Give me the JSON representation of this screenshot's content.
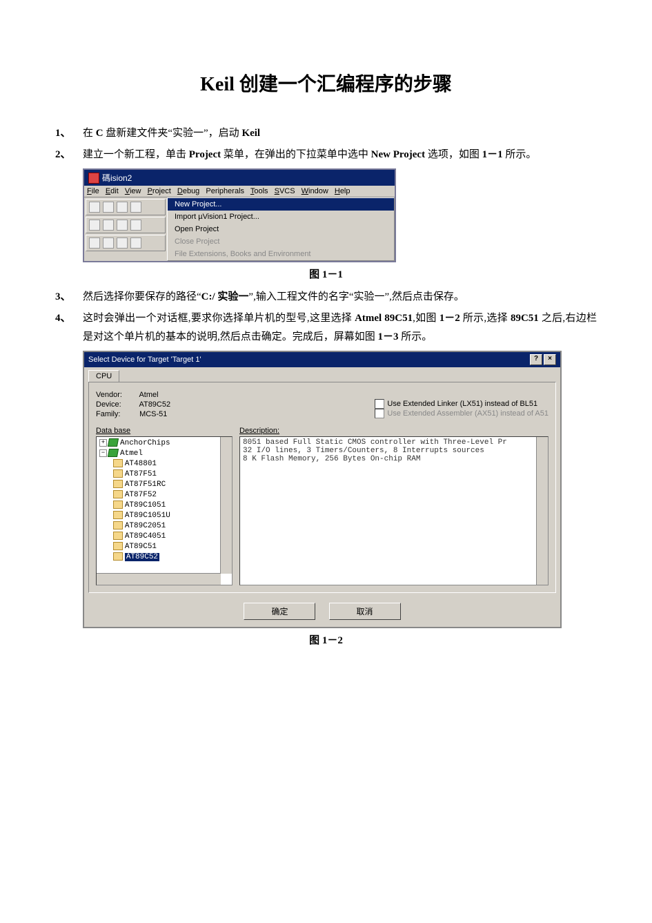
{
  "title": "Keil 创建一个汇编程序的步骤",
  "steps": {
    "s1": {
      "num": "1、",
      "text_a": "在 ",
      "b1": "C",
      "text_b": " 盘新建文件夹“实验一”，启动 ",
      "b2": "Keil"
    },
    "s2": {
      "num": "2、",
      "text_a": "建立一个新工程，单击 ",
      "b1": "Project",
      "text_b": " 菜单，在弹出的下拉菜单中选中 ",
      "b2": "New  Project",
      "text_c": " 选项，如图 ",
      "b3": "1－1",
      "text_d": " 所示。"
    },
    "s3": {
      "num": "3、",
      "text_a": "然后选择你要保存的路径“",
      "b1": "C:/  实验一",
      "text_b": "”,输入工程文件的名字“实验一”,然后点击保存。"
    },
    "s4": {
      "num": "4、",
      "text_a": "这时会弹出一个对话框,要求你选择单片机的型号,这里选择 ",
      "b1": "Atmel  89C51",
      "text_b": ",如图 ",
      "b2": "1－2",
      "text_c": " 所示,选择 ",
      "b3": "89C51",
      "text_d": " 之后,右边栏是对这个单片机的基本的说明,然后点击确定。完成后，屏幕如图 ",
      "b4": "1－3",
      "text_e": " 所示。"
    }
  },
  "fig_captions": {
    "c1": "图 1－1",
    "c2": "图 1－2"
  },
  "uvision": {
    "app_title": "碼ision2",
    "menubar": [
      "File",
      "Edit",
      "View",
      "Project",
      "Debug",
      "Peripherals",
      "Tools",
      "SVCS",
      "Window",
      "Help"
    ],
    "dropdown": [
      {
        "label": "New Project...",
        "selected": true,
        "disabled": false
      },
      {
        "label": "Import µVision1 Project...",
        "selected": false,
        "disabled": false
      },
      {
        "label": "Open Project",
        "selected": false,
        "disabled": false
      },
      {
        "label": "Close Project",
        "selected": false,
        "disabled": true
      },
      {
        "label": "File Extensions, Books and Environment",
        "selected": false,
        "disabled": true
      }
    ]
  },
  "device": {
    "dialog_title": "Select Device for Target 'Target 1'",
    "tab": "CPU",
    "vendor_label": "Vendor:",
    "vendor": "Atmel",
    "device_label": "Device:",
    "device_val": "AT89C52",
    "family_label": "Family:",
    "family": "MCS-51",
    "chk1": "Use Extended Linker (LX51) instead of BL51",
    "chk2": "Use Extended Assembler (AX51) instead of A51",
    "database_label": "Data base",
    "desc_label": "Description:",
    "tree": {
      "root1": "AnchorChips",
      "root2": "Atmel",
      "items": [
        "AT48801",
        "AT87F51",
        "AT87F51RC",
        "AT87F52",
        "AT89C1051",
        "AT89C1051U",
        "AT89C2051",
        "AT89C4051",
        "AT89C51",
        "AT89C52"
      ],
      "selected": "AT89C52"
    },
    "description_lines": [
      "8051 based Full Static CMOS controller with Three-Level Pr",
      "32  I/O lines, 3 Timers/Counters, 8 Interrupts sources",
      "8 K Flash Memory,  256 Bytes On-chip RAM"
    ],
    "btn_ok": "确定",
    "btn_cancel": "取消"
  }
}
